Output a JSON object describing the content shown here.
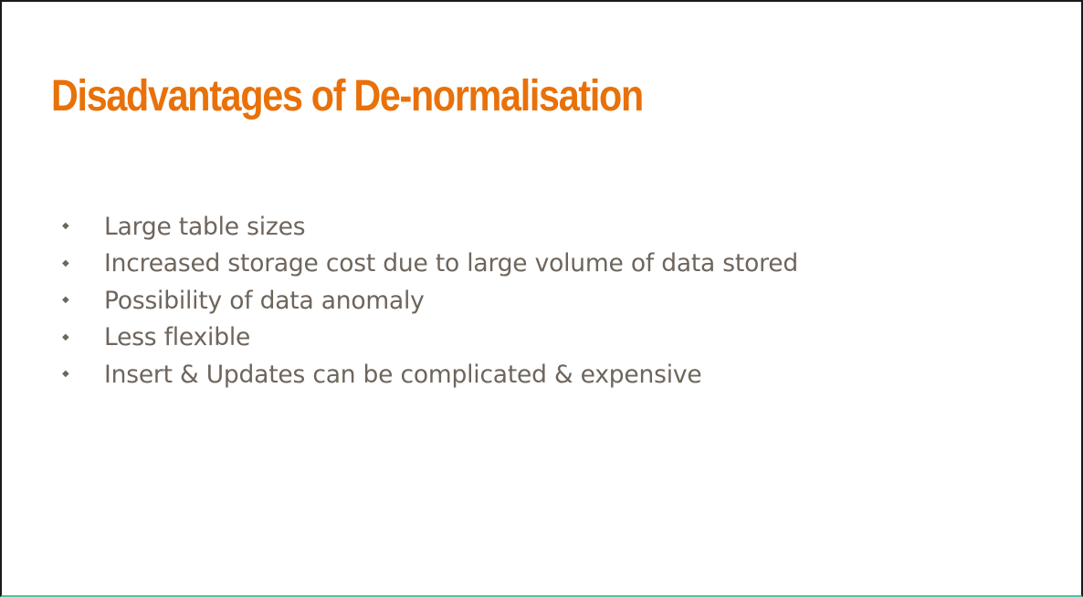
{
  "slide": {
    "title": "Disadvantages of De-normalisation",
    "bullets": [
      "Large table sizes",
      "Increased storage cost due to large volume of data stored",
      "Possibility of data anomaly",
      "Less flexible",
      "Insert & Updates can be complicated & expensive"
    ],
    "bullet_marker": "◆"
  },
  "colors": {
    "title": "#e8710a",
    "body_text": "#6e655c",
    "bullet": "#6e655c",
    "bottom_accent": "#4fc3a1"
  }
}
